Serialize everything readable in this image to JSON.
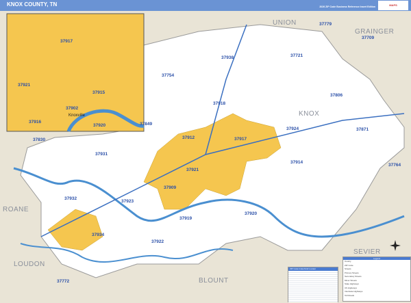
{
  "header": {
    "title": "KNOX COUNTY, TN",
    "edition": "2026 ZIP Code Business Reference Insert Edition",
    "logo": "Market MAPS"
  },
  "colors": {
    "header": "#6a93d4",
    "city": "#f5c64f",
    "county": "#ffffff",
    "surrounding": "#e9e4d6",
    "water": "#4a8fd0",
    "zip_label": "#2a4fa8"
  },
  "counties": [
    {
      "name": "UNION"
    },
    {
      "name": "GRAINGER"
    },
    {
      "name": "KNOX"
    },
    {
      "name": "SEVIER"
    },
    {
      "name": "BLOUNT"
    },
    {
      "name": "LOUDON"
    },
    {
      "name": "ROANE"
    }
  ],
  "zips": [
    "37938",
    "37721",
    "37779",
    "37709",
    "37754",
    "37806",
    "37918",
    "37849",
    "37924",
    "37871",
    "37912",
    "37917",
    "37830",
    "37931",
    "37914",
    "37764",
    "37921",
    "37909",
    "37932",
    "37923",
    "37919",
    "37920",
    "37934",
    "37922",
    "37772"
  ],
  "inset": {
    "zips": [
      "37917",
      "37921",
      "37915",
      "37902",
      "37916",
      "37920"
    ],
    "city": "Knoxville"
  },
  "index": {
    "title": "ZIP Code Index/Grid Locator"
  },
  "legend": {
    "title": "Legend",
    "items": [
      "County",
      "ZIP Code",
      "Streets",
      "Primary Streets",
      "Secondary Streets",
      "Minor Streets",
      "State Highways",
      "US Highways",
      "Interstate Highways",
      "Toll Roads"
    ]
  }
}
